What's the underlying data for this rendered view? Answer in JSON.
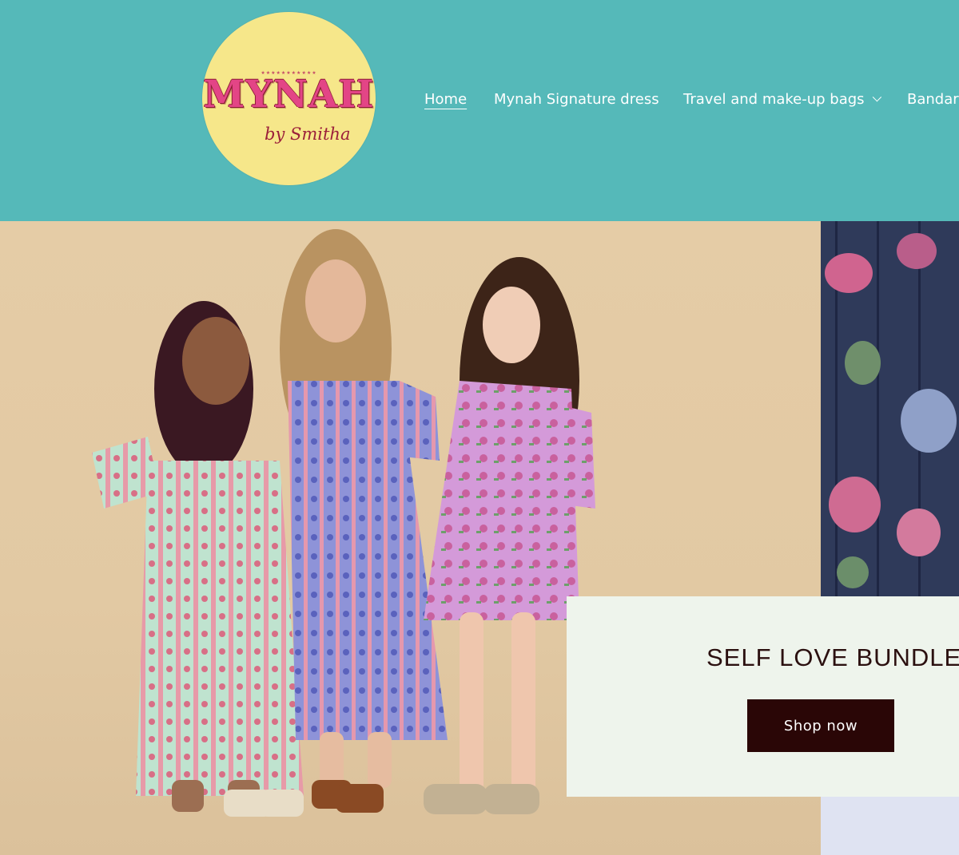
{
  "brand": {
    "logo_main": "MYNAH",
    "logo_sub": "by Smitha",
    "logo_stars": "★★★★★★★★★★★"
  },
  "nav": {
    "items": [
      {
        "label": "Home",
        "active": true
      },
      {
        "label": "Mynah Signature dress",
        "active": false
      },
      {
        "label": "Travel and make-up bags",
        "active": false,
        "has_dropdown": true
      },
      {
        "label": "Bandar",
        "active": false
      }
    ]
  },
  "hero": {
    "promo_title": "SELF LOVE BUNDLE",
    "cta_label": "Shop now"
  },
  "colors": {
    "header_bg": "#55b9b9",
    "logo_circle": "#f6e78a",
    "logo_text": "#e34586",
    "promo_bg": "#eef4ec",
    "button_bg": "#2a0606"
  }
}
